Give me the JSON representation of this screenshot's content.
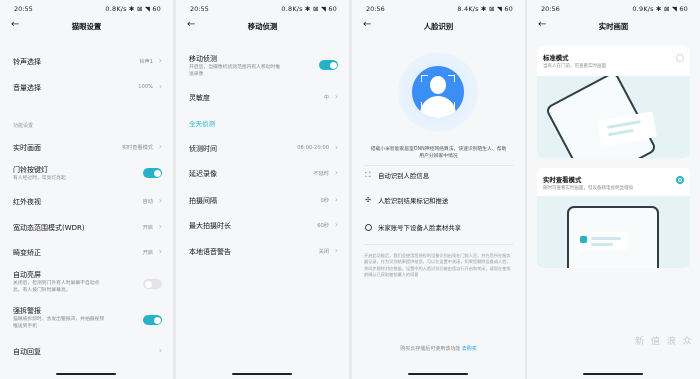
{
  "status": {
    "s1": {
      "time": "20:55",
      "net": "0.8K/s ✱ ⊠ ◥ 60"
    },
    "s2": {
      "time": "20:55",
      "net": "0.8K/s ✱ ⊠ ◥ 60"
    },
    "s3": {
      "time": "20:56",
      "net": "8.4K/s ✱ ⊠ ◥ 60"
    },
    "s4": {
      "time": "20:56",
      "net": "0.9K/s ✱ ⊠ ◥ 60"
    }
  },
  "s1": {
    "title": "猫眼设置",
    "ringtone": {
      "label": "铃声选择",
      "value": "铃声1"
    },
    "volume": {
      "label": "音量选择",
      "value": "100%"
    },
    "section": "功能设置",
    "live": {
      "label": "实时画面",
      "value": "实时查看模式"
    },
    "doorlight": {
      "label": "门铃按键灯",
      "sub": "有人经过时，常亮灯亮起"
    },
    "ir": {
      "label": "红外夜视",
      "value": "自动"
    },
    "wdr": {
      "label": "宽动态范围模式(WDR)",
      "value": "开启"
    },
    "distort": {
      "label": "畸变矫正",
      "value": "开启"
    },
    "autoscreen": {
      "label": "自动亮屏",
      "sub1": "关闭后，检测到门外有人时屏幕不自动点",
      "sub2": "亮，有人按门铃时屏幕亮。"
    },
    "tamper": {
      "label": "强拆警报",
      "sub1": "猫眼被拆卸时，会发出警报声，并拍摄视频",
      "sub2": "推送到手机"
    },
    "autoreply": {
      "label": "自动回复"
    }
  },
  "s2": {
    "title": "移动侦测",
    "motion": {
      "label": "移动侦测",
      "sub1": "开启后，当摄像机侦测范围内有人移动时推",
      "sub2": "送录像"
    },
    "sensitivity": {
      "label": "灵敏度",
      "value": "中"
    },
    "section": "全天侦测",
    "time": {
      "label": "侦测时间",
      "value": "08:00-20:00"
    },
    "delay": {
      "label": "延迟录像",
      "value": "不延时"
    },
    "interval": {
      "label": "拍摄间隔",
      "value": "0秒"
    },
    "duration": {
      "label": "最大拍摄时长",
      "value": "60秒"
    },
    "voice": {
      "label": "本地语音警告",
      "value": "关闭"
    }
  },
  "s3": {
    "title": "人脸识别",
    "desc": "搭载小米智能家居室DNN神经网络算法，快速识别陌生人、帮助用户分辨家中情况",
    "items": [
      {
        "icon": "⛶",
        "label": "自动识别人脸信息"
      },
      {
        "icon": "✣",
        "label": "人脸识别结果标记和推送"
      },
      {
        "icon": "",
        "label": "米家账号下设备人脸素材共享"
      }
    ],
    "note": "开启此功能后，我们会使用您授权的设备识别出现在门前人员，并在您所在服务器记录，作为识别结果提供给您，可以在设置中关闭，如果您删除设备或人脸，将同步删除对应数据，设置中的人脸识别功能由您自行开启和关闭，请您在使用前确认已获取被拍摄人的同意",
    "footer": "购买云存储后可使用该功能",
    "footer_link": "去购买"
  },
  "s4": {
    "title": "实时画面",
    "std": {
      "title": "标准模式",
      "sub": "当有人在门前，可查看实时画面"
    },
    "live": {
      "title": "实时查看模式",
      "sub": "随时可查看实时画面，但设备耗电会明显增加"
    }
  },
  "watermark": "新 值 浪 众",
  "colors": {
    "accent": "#27b3c6",
    "link": "#2e9bea"
  }
}
